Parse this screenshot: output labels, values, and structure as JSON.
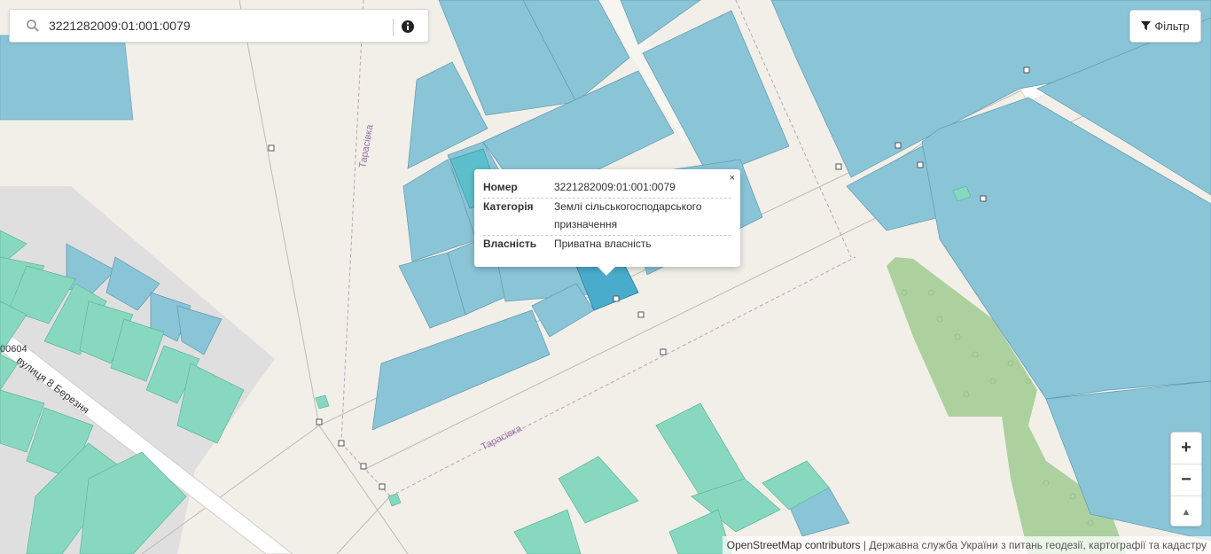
{
  "search": {
    "value": "3221282009:01:001:0079",
    "icon": "search-icon",
    "info_icon": "info-icon"
  },
  "filter": {
    "label": "Фільтр",
    "icon": "filter-icon"
  },
  "popup": {
    "rows": [
      {
        "key": "Номер",
        "value": "3221282009:01:001:0079"
      },
      {
        "key": "Категорія",
        "value": "Землі сільськогосподарського призначення"
      },
      {
        "key": "Власність",
        "value": "Приватна власність"
      }
    ],
    "close": "×"
  },
  "map_labels": {
    "street_1": "Тарасівка",
    "street_2": "Тарасівка",
    "street_3": "вулиця 8 Березня",
    "parcel_fragment": "00604"
  },
  "zoom": {
    "in": "+",
    "out": "−",
    "reset": "▲"
  },
  "attribution": {
    "osm": "OpenStreetMap contributors",
    "separator": "|",
    "gov": "Державна служба України з питань геодезії, картографії та кадастру"
  },
  "colors": {
    "background": "#f2efe9",
    "private_parcel": "#8ac4d7",
    "selected_parcel": "#4aaccc",
    "green_parcel": "#88d8c0",
    "forest": "#add19e",
    "residential": "#e0dfdf"
  }
}
